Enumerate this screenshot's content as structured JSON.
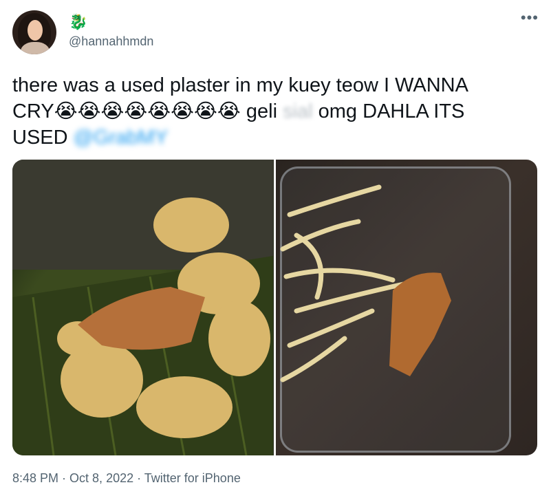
{
  "user": {
    "display_emoji": "🐉",
    "handle": "@hannahhmdn"
  },
  "tweet": {
    "line1": "there was a used plaster in my kuey teow I WANNA",
    "cry_prefix": "CRY",
    "cry_emojis": "😭😭😭😭😭😭😭😭",
    "after_emojis": " geli ",
    "blurred_word": "sial",
    "after_blur": " omg DAHLA ITS",
    "used": "USED ",
    "blurred_mention": "@GrabMY"
  },
  "more_icon": "•••",
  "footer": {
    "time": "8:48 PM",
    "sep1": " · ",
    "date": "Oct 8, 2022",
    "sep2": " · ",
    "source": "Twitter for iPhone"
  },
  "media": {
    "left_description_icon": "photo-icon",
    "right_description_icon": "photo-icon"
  }
}
